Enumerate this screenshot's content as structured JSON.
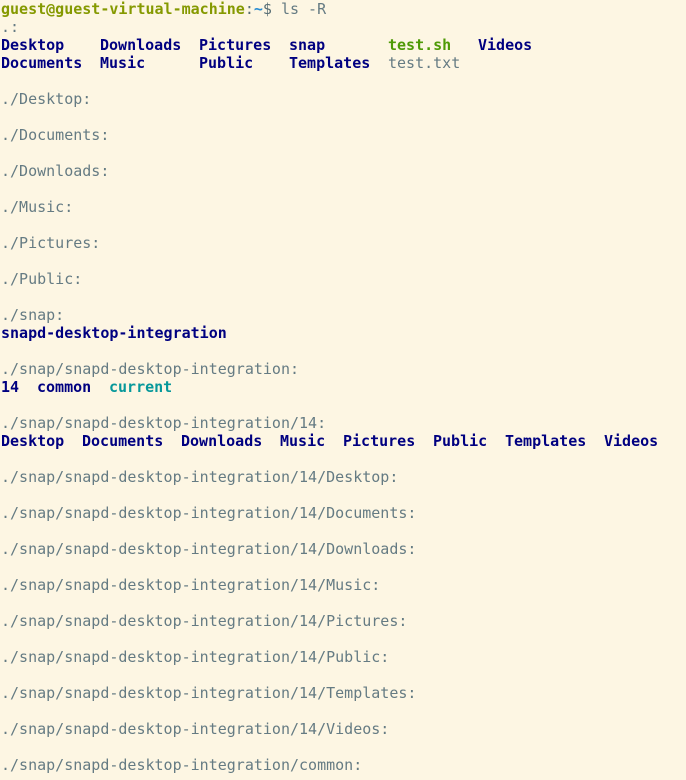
{
  "prompt": {
    "user_host": "guest@guest-virtual-machine",
    "separator": ":",
    "path": "~",
    "symbol": "$",
    "command": "ls -R"
  },
  "sections": [
    {
      "header": ".:",
      "entries": [
        {
          "name": "Desktop",
          "type": "dir"
        },
        {
          "name": "Downloads",
          "type": "dir"
        },
        {
          "name": "Pictures",
          "type": "dir"
        },
        {
          "name": "snap",
          "type": "dir"
        },
        {
          "name": "test.sh",
          "type": "exec"
        },
        {
          "name": "Videos",
          "type": "dir"
        },
        {
          "name": "Documents",
          "type": "dir"
        },
        {
          "name": "Music",
          "type": "dir"
        },
        {
          "name": "Public",
          "type": "dir"
        },
        {
          "name": "Templates",
          "type": "dir"
        },
        {
          "name": "test.txt",
          "type": "file"
        }
      ]
    },
    {
      "header": "./Desktop:",
      "entries": []
    },
    {
      "header": "./Documents:",
      "entries": []
    },
    {
      "header": "./Downloads:",
      "entries": []
    },
    {
      "header": "./Music:",
      "entries": []
    },
    {
      "header": "./Pictures:",
      "entries": []
    },
    {
      "header": "./Public:",
      "entries": []
    },
    {
      "header": "./snap:",
      "entries": [
        {
          "name": "snapd-desktop-integration",
          "type": "dir"
        }
      ]
    },
    {
      "header": "./snap/snapd-desktop-integration:",
      "entries": [
        {
          "name": "14",
          "type": "dir"
        },
        {
          "name": "common",
          "type": "dir"
        },
        {
          "name": "current",
          "type": "link"
        }
      ]
    },
    {
      "header": "./snap/snapd-desktop-integration/14:",
      "entries": [
        {
          "name": "Desktop",
          "type": "dir"
        },
        {
          "name": "Documents",
          "type": "dir"
        },
        {
          "name": "Downloads",
          "type": "dir"
        },
        {
          "name": "Music",
          "type": "dir"
        },
        {
          "name": "Pictures",
          "type": "dir"
        },
        {
          "name": "Public",
          "type": "dir"
        },
        {
          "name": "Templates",
          "type": "dir"
        },
        {
          "name": "Videos",
          "type": "dir"
        }
      ]
    },
    {
      "header": "./snap/snapd-desktop-integration/14/Desktop:",
      "entries": []
    },
    {
      "header": "./snap/snapd-desktop-integration/14/Documents:",
      "entries": []
    },
    {
      "header": "./snap/snapd-desktop-integration/14/Downloads:",
      "entries": []
    },
    {
      "header": "./snap/snapd-desktop-integration/14/Music:",
      "entries": []
    },
    {
      "header": "./snap/snapd-desktop-integration/14/Pictures:",
      "entries": []
    },
    {
      "header": "./snap/snapd-desktop-integration/14/Public:",
      "entries": []
    },
    {
      "header": "./snap/snapd-desktop-integration/14/Templates:",
      "entries": []
    },
    {
      "header": "./snap/snapd-desktop-integration/14/Videos:",
      "entries": []
    },
    {
      "header": "./snap/snapd-desktop-integration/common:",
      "entries": []
    }
  ],
  "colors": {
    "background": "#fdf6e3",
    "text": "#657b83",
    "directory": "#000080",
    "executable": "#4e9a06",
    "symlink": "#06989a",
    "prompt_user": "#859900",
    "prompt_path": "#268bd2"
  }
}
